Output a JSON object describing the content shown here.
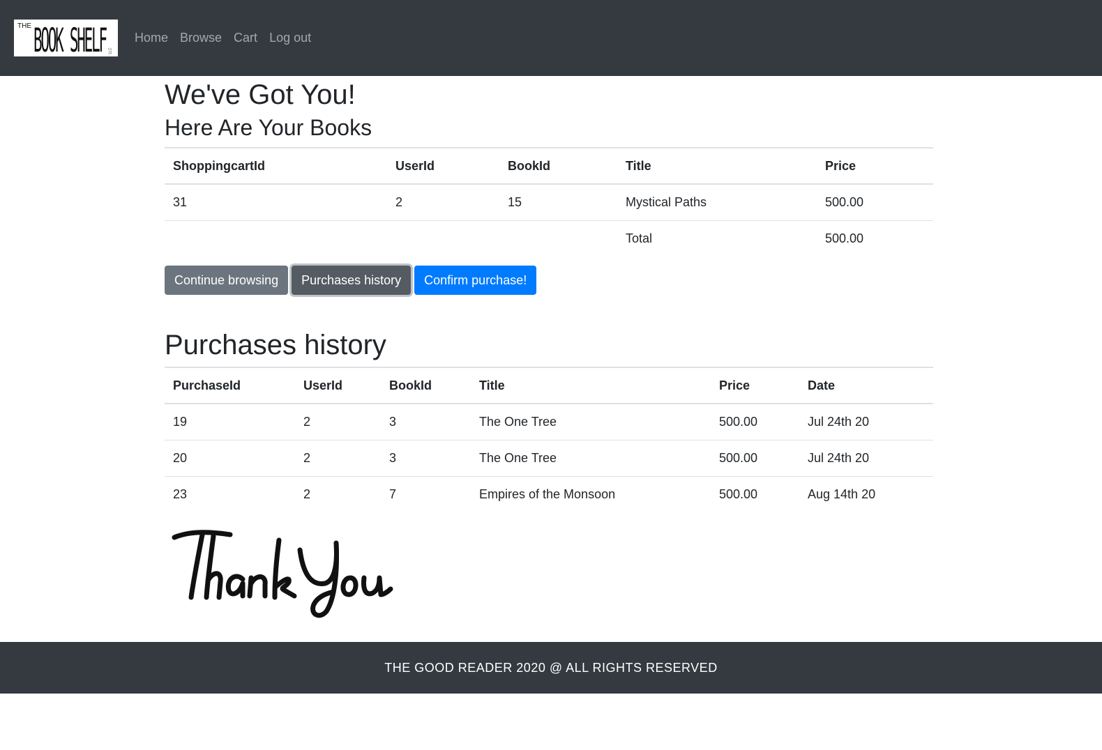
{
  "navbar": {
    "logo": {
      "the": "THE",
      "main": "BOOK SHELF",
      "llc": "LLC"
    },
    "links": [
      "Home",
      "Browse",
      "Cart",
      "Log out"
    ]
  },
  "cart": {
    "heading": "We've Got You!",
    "subheading": "Here Are Your Books",
    "columns": [
      "ShoppingcartId",
      "UserId",
      "BookId",
      "Title",
      "Price"
    ],
    "rows": [
      [
        "31",
        "2",
        "15",
        "Mystical Paths",
        "500.00"
      ]
    ],
    "total_label": "Total",
    "total_value": "500.00"
  },
  "buttons": {
    "continue": "Continue browsing",
    "history": "Purchases history",
    "confirm": "Confirm purchase!"
  },
  "history": {
    "heading": "Purchases history",
    "columns": [
      "PurchaseId",
      "UserId",
      "BookId",
      "Title",
      "Price",
      "Date"
    ],
    "rows": [
      [
        "19",
        "2",
        "3",
        "The One Tree",
        "500.00",
        "Jul 24th 20"
      ],
      [
        "20",
        "2",
        "3",
        "The One Tree",
        "500.00",
        "Jul 24th 20"
      ],
      [
        "23",
        "2",
        "7",
        "Empires of the Monsoon",
        "500.00",
        "Aug 14th 20"
      ]
    ]
  },
  "thankyou_image": "Thank You",
  "footer": {
    "text": "THE GOOD READER 2020 @ ALL RIGHTS RESERVED"
  },
  "colors": {
    "navbar": "#343a40",
    "primary": "#007bff",
    "secondary": "#6c757d"
  }
}
